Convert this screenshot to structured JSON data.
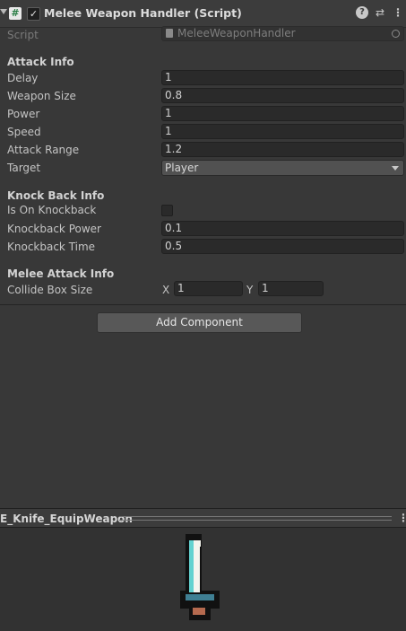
{
  "component": {
    "title": "Melee Weapon Handler (Script)",
    "script_label": "Script",
    "script_value": "MeleeWeaponHandler",
    "enabled": true,
    "icons": [
      "help-icon",
      "settings-icon",
      "menu-icon"
    ]
  },
  "attack_info": {
    "header": "Attack Info",
    "delay_label": "Delay",
    "delay_value": "1",
    "weapon_size_label": "Weapon Size",
    "weapon_size_value": "0.8",
    "power_label": "Power",
    "power_value": "1",
    "speed_label": "Speed",
    "speed_value": "1",
    "attack_range_label": "Attack Range",
    "attack_range_value": "1.2",
    "target_label": "Target",
    "target_value": "Player"
  },
  "knockback_info": {
    "header": "Knock Back Info",
    "is_on_label": "Is On Knockback",
    "is_on_value": false,
    "power_label": "Knockback Power",
    "power_value": "0.1",
    "time_label": "Knockback Time",
    "time_value": "0.5"
  },
  "melee_attack_info": {
    "header": "Melee Attack Info",
    "collide_label": "Collide Box Size",
    "x_label": "X",
    "x_value": "1",
    "y_label": "Y",
    "y_value": "1"
  },
  "add_component_label": "Add Component",
  "preview": {
    "title": "E_Knife_EquipWeapon"
  },
  "colors": {
    "blade_light": "#f4f4ee",
    "blade_cyan": "#63d2d0",
    "guard": "#3f7f93",
    "handle": "#b56a4f",
    "outline": "#111111"
  }
}
